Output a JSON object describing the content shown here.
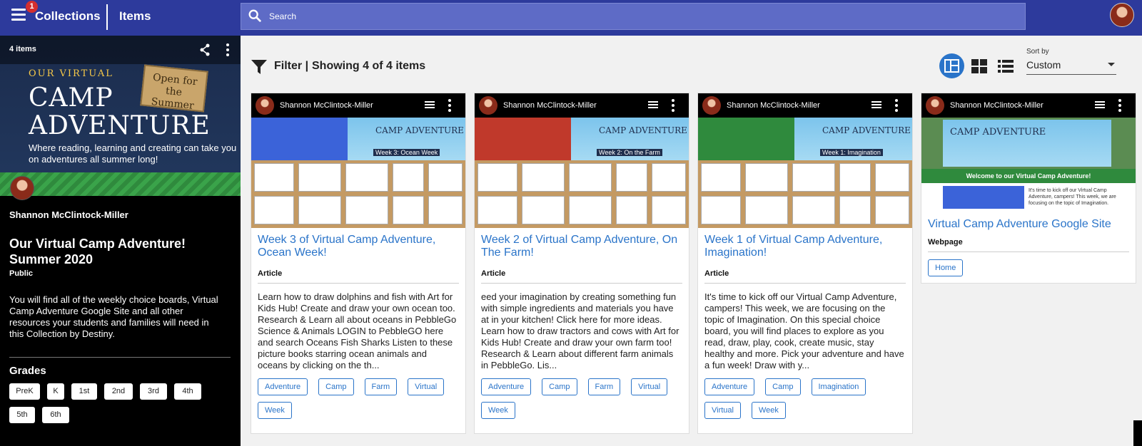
{
  "topbar": {
    "notification_count": "1",
    "collections_label": "Collections",
    "items_label": "Items",
    "search_placeholder": "Search"
  },
  "sidebar": {
    "items_count": "4 items",
    "banner": {
      "our_virtual": "OUR VIRTUAL",
      "camp": "CAMP",
      "adventure": "ADVENTURE",
      "sign": "Open for the Summer",
      "tagline": "Where reading, learning and creating can take you on adventures all summer long!"
    },
    "owner": "Shannon McClintock-Miller",
    "title": "Our Virtual Camp Adventure! Summer 2020",
    "visibility": "Public",
    "description": "You will find all of the weekly choice boards, Virtual Camp Adventure Google Site and all other resources your students and families will need in this Collection by Destiny.",
    "grades_title": "Grades",
    "grades": [
      "PreK",
      "K",
      "1st",
      "2nd",
      "3rd",
      "4th",
      "5th",
      "6th"
    ]
  },
  "main": {
    "filter_label": "Filter |",
    "showing": "Showing 4 of 4 items",
    "sort_label": "Sort by",
    "sort_value": "Custom"
  },
  "cards": [
    {
      "author": "Shannon McClintock-Miller",
      "thumb_camp": "CAMP ADVENTURE",
      "thumb_week": "Week 3: Ocean Week",
      "thumb_color": "#3b63d9",
      "title": "Week 3 of Virtual Camp Adventure, Ocean Week!",
      "type": "Article",
      "description": "Learn how to draw dolphins and fish with Art for Kids Hub! Create and draw your own ocean too. Research & Learn all about oceans in PebbleGo Science & Animals LOGIN to PebbleGO here and search Oceans Fish Sharks Listen to these picture books starring ocean animals and oceans by clicking on the th...",
      "tags": [
        "Adventure",
        "Camp",
        "Farm",
        "Virtual",
        "Week"
      ]
    },
    {
      "author": "Shannon McClintock-Miller",
      "thumb_camp": "CAMP ADVENTURE",
      "thumb_week": "Week 2: On the Farm",
      "thumb_color": "#c0392b",
      "title": "Week 2 of Virtual Camp Adventure, On The Farm!",
      "type": "Article",
      "description": "eed your imagination by creating something fun with simple ingredients and materials you have at in your kitchen! Click here for more ideas. Learn how to draw tractors and cows with Art for Kids Hub! Create and draw your own farm too! Research & Learn about different farm animals in PebbleGo. Lis...",
      "tags": [
        "Adventure",
        "Camp",
        "Farm",
        "Virtual",
        "Week"
      ]
    },
    {
      "author": "Shannon McClintock-Miller",
      "thumb_camp": "CAMP ADVENTURE",
      "thumb_week": "Week 1: Imagination",
      "thumb_color": "#2f8a3d",
      "title": "Week 1 of Virtual Camp Adventure, Imagination!",
      "type": "Article",
      "description": "It's time to kick off our Virtual Camp Adventure, campers! This week, we are focusing on the topic of Imagination. On this special choice board, you will find places to explore as you read, draw, play, cook, create music, stay healthy and more. Pick your adventure and have a fun week! Draw with y...",
      "tags": [
        "Adventure",
        "Camp",
        "Imagination",
        "Virtual",
        "Week"
      ]
    },
    {
      "author": "Shannon McClintock-Miller",
      "thumb_camp": "CAMP ADVENTURE",
      "thumb_welcome": "Welcome to our Virtual Camp Adventure!",
      "thumb_text": "It's time to kick off our Virtual Camp Adventure, campers! This week, we are focusing on the topic of Imagination.",
      "title": "Virtual Camp Adventure Google Site",
      "type": "Webpage",
      "button": "Home"
    }
  ],
  "colors": {
    "topbar": "#2d3a9c",
    "accent": "#2a74c9",
    "sidebar": "#000000"
  }
}
